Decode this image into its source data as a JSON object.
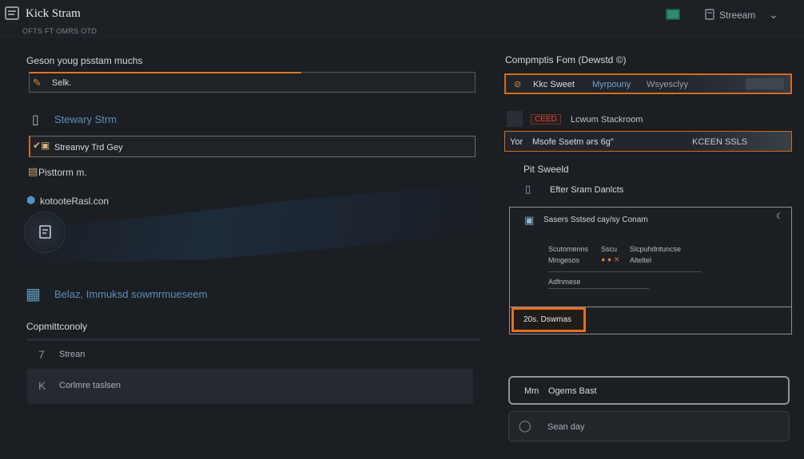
{
  "header": {
    "title": "Kick Stram",
    "subtitle": "OFTS FT OMRS OTD",
    "user_label": "Streeam"
  },
  "left": {
    "heading": "Geson youg psstam muchs",
    "field1_text": "Selk.",
    "link1": "Stewary Strm",
    "field2_text": "Streanvy Trd Gey",
    "item_platform": "Pisttorm m.",
    "item_host": "kotooteRasl.con",
    "blue_heading": "Belaz, Immuksd sowmrmueseem",
    "section2": "Copmittconoly",
    "rows": [
      {
        "icon": "7",
        "label": "Strean"
      },
      {
        "icon": "K",
        "label": "Corlmre taslsen"
      }
    ]
  },
  "right": {
    "heading": "Compmptis Fom (Dewstd ©)",
    "field1_left": "Kkc Sweet",
    "field1_mid": "Myrpouny",
    "field1_right": "Wsyesclyy",
    "row2_tag": "CEED",
    "row2_text": "Lcwum Stackroom",
    "field2_left": "Yor",
    "field2_text": "Msofe Ssetm ərs 6g\"",
    "field2_right": "KCEEN SSLS",
    "section_title": "Pit Sweeld",
    "sub_item": "Efter Sram Danlcts",
    "card": {
      "title": "Sasers Sstsed cay/sy Conam",
      "row1_left": "Scutomenns",
      "row1_mid": "Sscu",
      "row1_right": "Slcpuhdntuncse",
      "row2_left": "Mmgesos",
      "row2_right": "Alteltel",
      "row3": "Adfnmese",
      "button": "20s. Dswmas"
    },
    "pill1_left": "Mm",
    "pill1_text": "Ogems Bast",
    "pill2_text": "Sean day"
  }
}
